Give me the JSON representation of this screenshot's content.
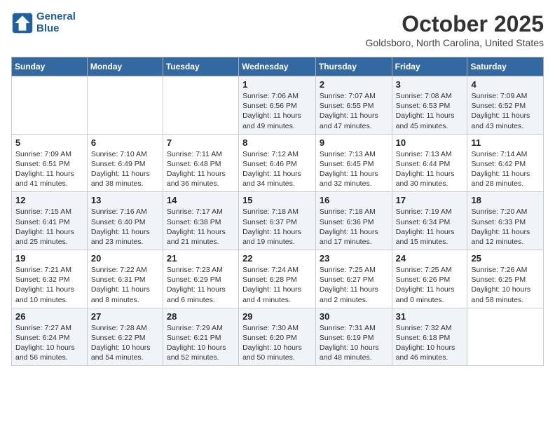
{
  "header": {
    "logo_line1": "General",
    "logo_line2": "Blue",
    "month_title": "October 2025",
    "subtitle": "Goldsboro, North Carolina, United States"
  },
  "weekdays": [
    "Sunday",
    "Monday",
    "Tuesday",
    "Wednesday",
    "Thursday",
    "Friday",
    "Saturday"
  ],
  "weeks": [
    [
      {
        "day": "",
        "info": ""
      },
      {
        "day": "",
        "info": ""
      },
      {
        "day": "",
        "info": ""
      },
      {
        "day": "1",
        "info": "Sunrise: 7:06 AM\nSunset: 6:56 PM\nDaylight: 11 hours\nand 49 minutes."
      },
      {
        "day": "2",
        "info": "Sunrise: 7:07 AM\nSunset: 6:55 PM\nDaylight: 11 hours\nand 47 minutes."
      },
      {
        "day": "3",
        "info": "Sunrise: 7:08 AM\nSunset: 6:53 PM\nDaylight: 11 hours\nand 45 minutes."
      },
      {
        "day": "4",
        "info": "Sunrise: 7:09 AM\nSunset: 6:52 PM\nDaylight: 11 hours\nand 43 minutes."
      }
    ],
    [
      {
        "day": "5",
        "info": "Sunrise: 7:09 AM\nSunset: 6:51 PM\nDaylight: 11 hours\nand 41 minutes."
      },
      {
        "day": "6",
        "info": "Sunrise: 7:10 AM\nSunset: 6:49 PM\nDaylight: 11 hours\nand 38 minutes."
      },
      {
        "day": "7",
        "info": "Sunrise: 7:11 AM\nSunset: 6:48 PM\nDaylight: 11 hours\nand 36 minutes."
      },
      {
        "day": "8",
        "info": "Sunrise: 7:12 AM\nSunset: 6:46 PM\nDaylight: 11 hours\nand 34 minutes."
      },
      {
        "day": "9",
        "info": "Sunrise: 7:13 AM\nSunset: 6:45 PM\nDaylight: 11 hours\nand 32 minutes."
      },
      {
        "day": "10",
        "info": "Sunrise: 7:13 AM\nSunset: 6:44 PM\nDaylight: 11 hours\nand 30 minutes."
      },
      {
        "day": "11",
        "info": "Sunrise: 7:14 AM\nSunset: 6:42 PM\nDaylight: 11 hours\nand 28 minutes."
      }
    ],
    [
      {
        "day": "12",
        "info": "Sunrise: 7:15 AM\nSunset: 6:41 PM\nDaylight: 11 hours\nand 25 minutes."
      },
      {
        "day": "13",
        "info": "Sunrise: 7:16 AM\nSunset: 6:40 PM\nDaylight: 11 hours\nand 23 minutes."
      },
      {
        "day": "14",
        "info": "Sunrise: 7:17 AM\nSunset: 6:38 PM\nDaylight: 11 hours\nand 21 minutes."
      },
      {
        "day": "15",
        "info": "Sunrise: 7:18 AM\nSunset: 6:37 PM\nDaylight: 11 hours\nand 19 minutes."
      },
      {
        "day": "16",
        "info": "Sunrise: 7:18 AM\nSunset: 6:36 PM\nDaylight: 11 hours\nand 17 minutes."
      },
      {
        "day": "17",
        "info": "Sunrise: 7:19 AM\nSunset: 6:34 PM\nDaylight: 11 hours\nand 15 minutes."
      },
      {
        "day": "18",
        "info": "Sunrise: 7:20 AM\nSunset: 6:33 PM\nDaylight: 11 hours\nand 12 minutes."
      }
    ],
    [
      {
        "day": "19",
        "info": "Sunrise: 7:21 AM\nSunset: 6:32 PM\nDaylight: 11 hours\nand 10 minutes."
      },
      {
        "day": "20",
        "info": "Sunrise: 7:22 AM\nSunset: 6:31 PM\nDaylight: 11 hours\nand 8 minutes."
      },
      {
        "day": "21",
        "info": "Sunrise: 7:23 AM\nSunset: 6:29 PM\nDaylight: 11 hours\nand 6 minutes."
      },
      {
        "day": "22",
        "info": "Sunrise: 7:24 AM\nSunset: 6:28 PM\nDaylight: 11 hours\nand 4 minutes."
      },
      {
        "day": "23",
        "info": "Sunrise: 7:25 AM\nSunset: 6:27 PM\nDaylight: 11 hours\nand 2 minutes."
      },
      {
        "day": "24",
        "info": "Sunrise: 7:25 AM\nSunset: 6:26 PM\nDaylight: 11 hours\nand 0 minutes."
      },
      {
        "day": "25",
        "info": "Sunrise: 7:26 AM\nSunset: 6:25 PM\nDaylight: 10 hours\nand 58 minutes."
      }
    ],
    [
      {
        "day": "26",
        "info": "Sunrise: 7:27 AM\nSunset: 6:24 PM\nDaylight: 10 hours\nand 56 minutes."
      },
      {
        "day": "27",
        "info": "Sunrise: 7:28 AM\nSunset: 6:22 PM\nDaylight: 10 hours\nand 54 minutes."
      },
      {
        "day": "28",
        "info": "Sunrise: 7:29 AM\nSunset: 6:21 PM\nDaylight: 10 hours\nand 52 minutes."
      },
      {
        "day": "29",
        "info": "Sunrise: 7:30 AM\nSunset: 6:20 PM\nDaylight: 10 hours\nand 50 minutes."
      },
      {
        "day": "30",
        "info": "Sunrise: 7:31 AM\nSunset: 6:19 PM\nDaylight: 10 hours\nand 48 minutes."
      },
      {
        "day": "31",
        "info": "Sunrise: 7:32 AM\nSunset: 6:18 PM\nDaylight: 10 hours\nand 46 minutes."
      },
      {
        "day": "",
        "info": ""
      }
    ]
  ]
}
